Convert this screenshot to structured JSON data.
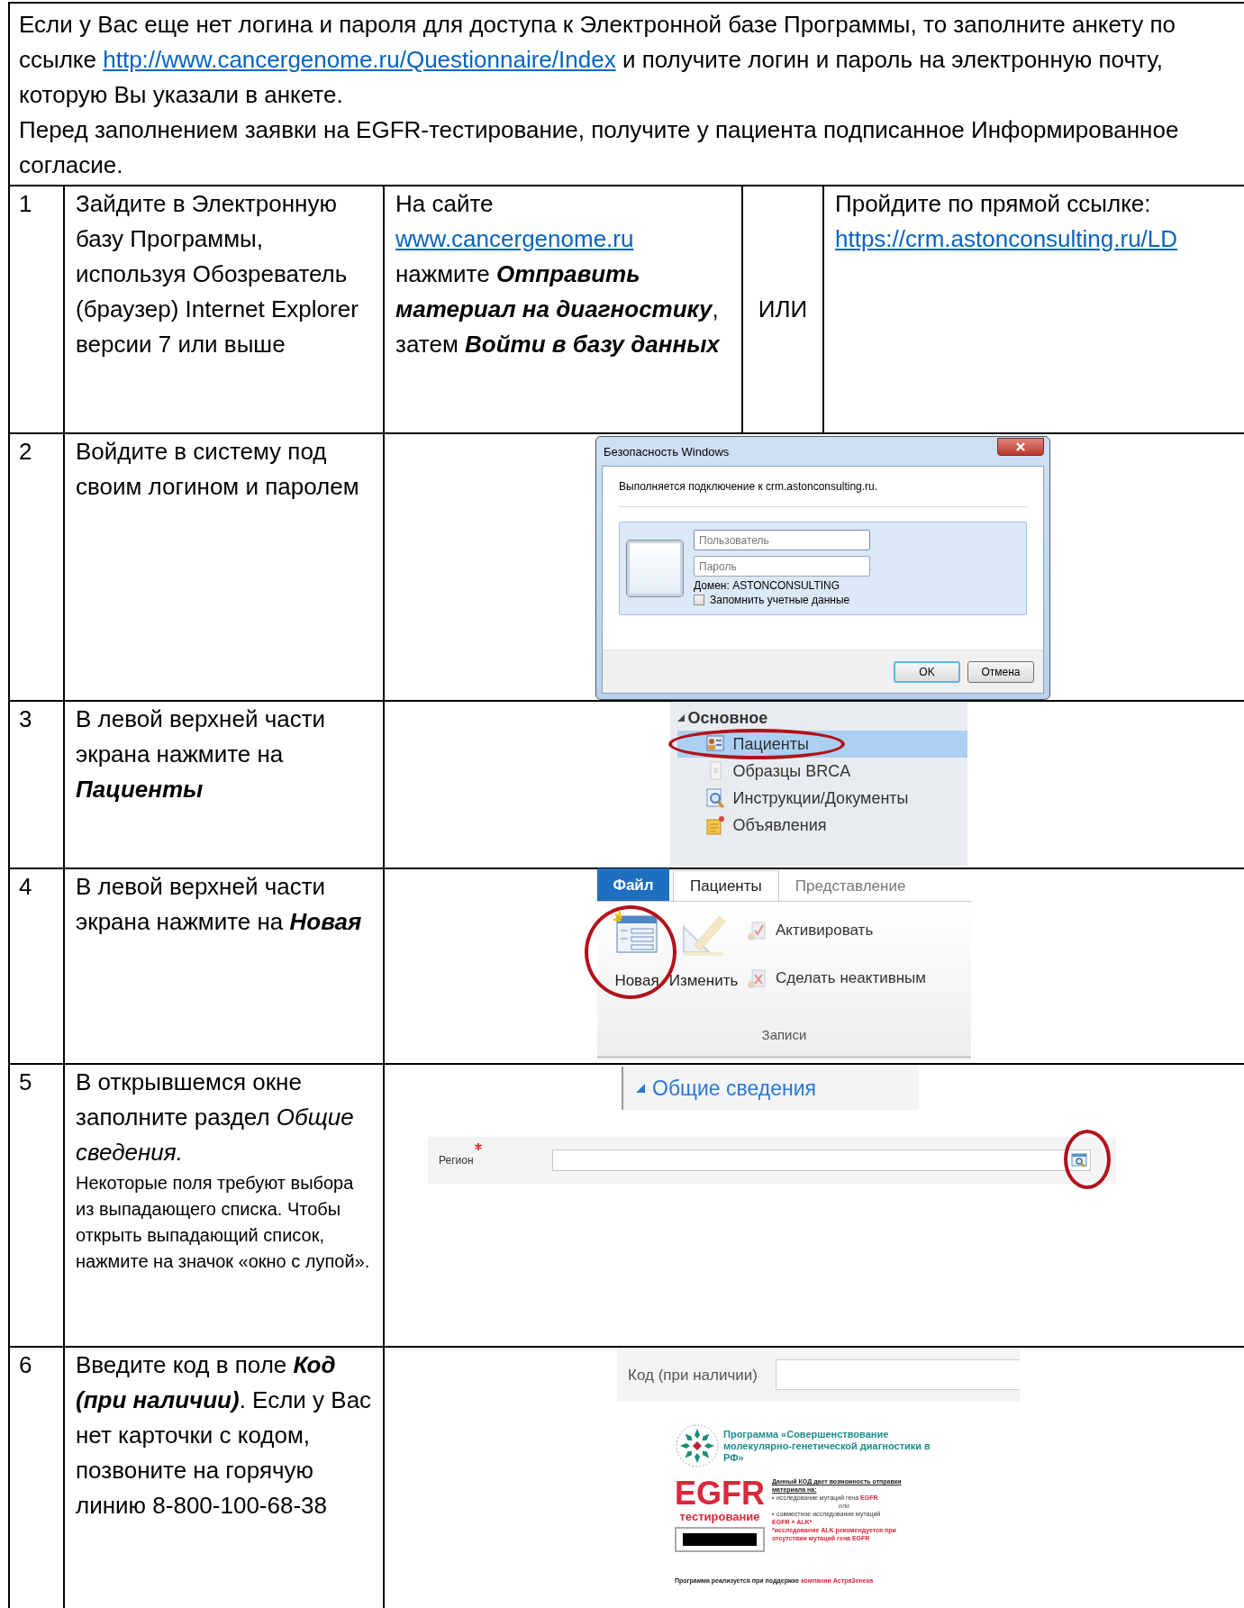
{
  "intro": [
    {
      "segments": [
        {
          "kind": "plain",
          "text": "Если у Вас еще нет логина и пароля для доступа к Электронной базе Программы, то заполните анкету по ссылке "
        },
        {
          "kind": "link",
          "text": "http://www.cancergenome.ru/Questionnaire/Index"
        },
        {
          "kind": "plain",
          "text": " и получите логин и пароль на электронную почту, которую Вы указали в анкете."
        }
      ]
    },
    {
      "segments": [
        {
          "kind": "plain",
          "text": "Перед заполнением заявки на EGFR-тестирование, получите у пациента подписанное Информированное согласие."
        }
      ]
    }
  ],
  "steps": [
    {
      "number": "1",
      "instruction": [
        {
          "kind": "main",
          "segments": [
            {
              "kind": "plain",
              "text": "Зайдите в Электронную базу Программы, используя Обозреватель (браузер) Internet Explorer версии 7 или выше"
            }
          ]
        }
      ],
      "options": {
        "site": {
          "segments": [
            {
              "kind": "plain",
              "text": "На сайте "
            },
            {
              "kind": "link",
              "text": "www.cancergenome.ru"
            },
            {
              "kind": "plain",
              "text": " нажмите "
            },
            {
              "kind": "emphasis",
              "text": "Отправить материал на диагностику"
            },
            {
              "kind": "plain",
              "text": ", затем "
            },
            {
              "kind": "emphasis",
              "text": "Войти в базу данных"
            }
          ]
        },
        "separator": "ИЛИ",
        "direct": {
          "segments": [
            {
              "kind": "plain",
              "text": "Пройдите по прямой ссылке: "
            },
            {
              "kind": "link",
              "text": "https://crm.astonconsulting.ru/LD"
            }
          ]
        }
      }
    },
    {
      "number": "2",
      "instruction": [
        {
          "kind": "main",
          "segments": [
            {
              "kind": "plain",
              "text": "Войдите в систему под своим логином и паролем"
            }
          ]
        }
      ],
      "illustration": {
        "kind": "login_dialog",
        "title": "Безопасность Windows",
        "message": "Выполняется подключение к crm.astonconsulting.ru.",
        "username_placeholder": "Пользователь",
        "password_placeholder": "Пароль",
        "domain": "Домен: ASTONCONSULTING",
        "remember": {
          "label": "Запомнить учетные данные",
          "checked": false
        },
        "buttons": [
          "OK",
          "Отмена"
        ]
      }
    },
    {
      "number": "3",
      "instruction": [
        {
          "kind": "main",
          "segments": [
            {
              "kind": "plain",
              "text": "В левой верхней части экрана нажмите на "
            },
            {
              "kind": "emphasis",
              "text": "Пациенты"
            }
          ]
        }
      ],
      "illustration": {
        "kind": "nav_menu",
        "heading": "Основное",
        "items": [
          {
            "label": "Пациенты",
            "selected": true
          },
          {
            "label": "Образцы BRCA",
            "selected": false
          },
          {
            "label": "Инструкции/Документы",
            "selected": false
          },
          {
            "label": "Объявления",
            "selected": false
          }
        ]
      }
    },
    {
      "number": "4",
      "instruction": [
        {
          "kind": "main",
          "segments": [
            {
              "kind": "plain",
              "text": "В левой верхней части экрана нажмите на "
            },
            {
              "kind": "emphasis",
              "text": "Новая"
            }
          ]
        }
      ],
      "illustration": {
        "kind": "ribbon",
        "file_tab": "Файл",
        "tabs": [
          {
            "label": "Пациенты",
            "selected": true
          },
          {
            "label": "Представление",
            "selected": false
          }
        ],
        "large_buttons": [
          "Новая",
          "Изменить"
        ],
        "small_buttons": [
          "Активировать",
          "Сделать неактивным"
        ],
        "group": "Записи"
      }
    },
    {
      "number": "5",
      "instruction": [
        {
          "kind": "main",
          "segments": [
            {
              "kind": "plain",
              "text": "В открывшемся окне заполните раздел "
            },
            {
              "kind": "italic",
              "text": "Общие сведения."
            }
          ]
        },
        {
          "kind": "note",
          "segments": [
            {
              "kind": "plain",
              "text": "Некоторые поля требуют выбора из выпадающего списка. Чтобы открыть выпадающий список, нажмите на значок «окно с лупой»."
            }
          ]
        }
      ],
      "illustration": {
        "kind": "form_section",
        "section": "Общие сведения",
        "field": "Регион",
        "required": true
      }
    },
    {
      "number": "6",
      "instruction": [
        {
          "kind": "main",
          "segments": [
            {
              "kind": "plain",
              "text": "Введите код в поле "
            },
            {
              "kind": "emphasis",
              "text": "Код (при наличии)"
            },
            {
              "kind": "plain",
              "text": ". Если у Вас нет карточки с кодом, позвоните на горячую линию 8-800-100-68-38"
            }
          ]
        }
      ],
      "illustration": {
        "kind": "code_card",
        "field": "Код (при наличии)",
        "program": "Программа «Совершенствование молекулярно-генетической диагностики в РФ»",
        "test_name": "EGFR",
        "test_subtitle": "тестирование",
        "note_heading": "Данный КОД дает возможность отправки материала на:",
        "note_items": [
          {
            "text": "исследование мутаций гена **EGFR**",
            "kind": "bullet"
          },
          {
            "text": "или",
            "kind": "connector"
          },
          {
            "text": "совместное исследование мутаций",
            "kind": "bullet"
          },
          {
            "text": "EGFR + ALK*",
            "kind": "highlight"
          },
          {
            "text": "*исследование ALK рекомендуется при отсутствии мутаций гена EGFR",
            "kind": "highlight"
          }
        ],
        "footer": "Программа реализуется при поддержке **компании АстраЗенека**"
      }
    }
  ]
}
